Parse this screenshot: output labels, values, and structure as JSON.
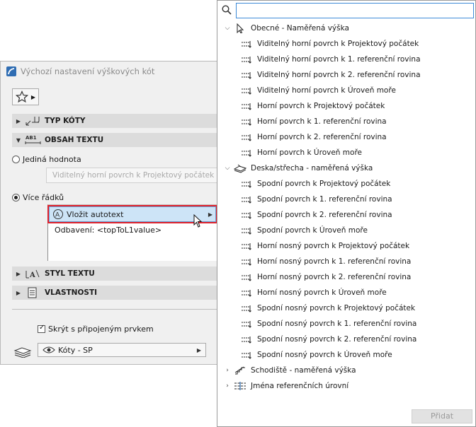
{
  "dialog": {
    "title": "Výchozí nastavení výškových kót",
    "sections": {
      "dimension_type": "TYP KÓTY",
      "text_content": "OBSAH TEXTU",
      "text_style": "STYL TEXTU",
      "properties": "VLASTNOSTI"
    },
    "single_value_label": "Jediná hodnota",
    "single_value_field": "Viditelný horní povrch k Projektový počátek",
    "multi_line_label": "Více řádků",
    "insert_autotext_label": "Vložit autotext",
    "formula_text": "Odbavení: <topToL1value>",
    "hide_with_element_label": "Skrýt s připojeným prvkem",
    "layer_value": "Kóty - SP"
  },
  "popup": {
    "search_value": "",
    "groups": [
      {
        "label": "Obecné - Naměřená výška",
        "icon": "cursor-arrow-icon",
        "expanded": true,
        "items": [
          "Viditelný horní povrch k Projektový počátek",
          "Viditelný horní povrch k 1. referenční rovina",
          "Viditelný horní povrch k 2. referenční rovina",
          "Viditelný horní povrch k Úroveň moře",
          "Horní povrch k Projektový počátek",
          "Horní povrch k 1. referenční rovina",
          "Horní povrch k 2. referenční rovina",
          "Horní povrch k Úroveň moře"
        ]
      },
      {
        "label": "Deska/střecha - naměřená výška",
        "icon": "slab-roof-icon",
        "expanded": true,
        "items": [
          "Spodní povrch k Projektový počátek",
          "Spodní povrch k 1. referenční rovina",
          "Spodní povrch k 2. referenční rovina",
          "Spodní povrch k Úroveň moře",
          "Horní nosný povrch k Projektový počátek",
          "Horní nosný povrch k 1. referenční rovina",
          "Horní nosný povrch k 2. referenční rovina",
          "Horní nosný povrch k Úroveň moře",
          "Spodní nosný povrch k Projektový počátek",
          "Spodní nosný povrch k 1. referenční rovina",
          "Spodní nosný povrch k 2. referenční rovina",
          "Spodní nosný povrch k Úroveň moře"
        ]
      },
      {
        "label": "Schodiště - naměřená výška",
        "icon": "stair-icon",
        "expanded": false,
        "items": []
      },
      {
        "label": "Jména referenčních úrovní",
        "icon": "reference-levels-icon",
        "expanded": false,
        "items": []
      }
    ],
    "add_button_label": "Přidat"
  },
  "colors": {
    "highlight_border": "#e0202a",
    "highlight_fill": "#cde4f7",
    "search_focus": "#3c8ad8"
  }
}
